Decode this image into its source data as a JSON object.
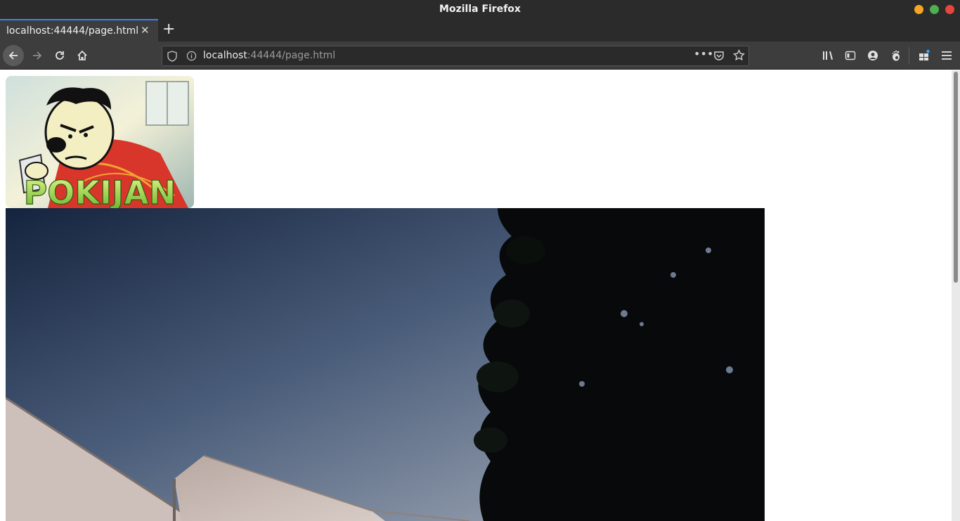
{
  "window": {
    "title": "Mozilla Firefox"
  },
  "tabs": [
    {
      "label": "localhost:44444/page.html",
      "active": true
    }
  ],
  "urlbar": {
    "host": "localhost",
    "rest": ":44444/page.html"
  },
  "logo": {
    "text": "POKIJAN"
  },
  "colors": {
    "accent": "#3b82f6",
    "chrome_dark": "#2b2b2b",
    "toolbar": "#3d3d3d"
  }
}
